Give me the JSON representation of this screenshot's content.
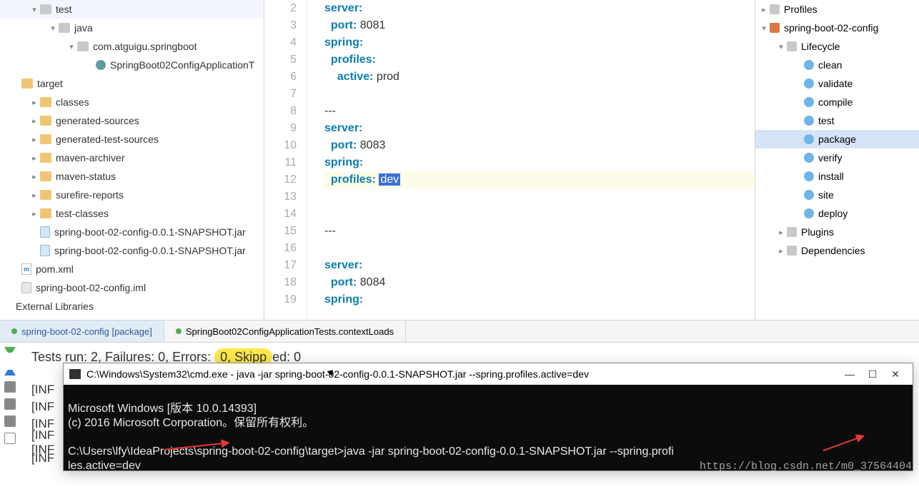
{
  "projectTree": {
    "items": [
      {
        "indent": 40,
        "arrow": "▾",
        "iconClass": "icon-folder gray",
        "label": "test"
      },
      {
        "indent": 66,
        "arrow": "▾",
        "iconClass": "icon-folder gray",
        "label": "java"
      },
      {
        "indent": 92,
        "arrow": "▾",
        "iconClass": "icon-folder gray",
        "label": "com.atguigu.springboot"
      },
      {
        "indent": 118,
        "arrow": "",
        "iconClass": "icon-class",
        "label": "SpringBoot02ConfigApplicationT"
      },
      {
        "indent": 14,
        "arrow": "",
        "iconClass": "icon-folder",
        "label": "target"
      },
      {
        "indent": 40,
        "arrow": "▸",
        "iconClass": "icon-folder",
        "label": "classes"
      },
      {
        "indent": 40,
        "arrow": "▸",
        "iconClass": "icon-folder",
        "label": "generated-sources"
      },
      {
        "indent": 40,
        "arrow": "▸",
        "iconClass": "icon-folder",
        "label": "generated-test-sources"
      },
      {
        "indent": 40,
        "arrow": "▸",
        "iconClass": "icon-folder",
        "label": "maven-archiver"
      },
      {
        "indent": 40,
        "arrow": "▸",
        "iconClass": "icon-folder",
        "label": "maven-status"
      },
      {
        "indent": 40,
        "arrow": "▸",
        "iconClass": "icon-folder",
        "label": "surefire-reports"
      },
      {
        "indent": 40,
        "arrow": "▸",
        "iconClass": "icon-folder",
        "label": "test-classes"
      },
      {
        "indent": 40,
        "arrow": "",
        "iconClass": "icon-jar",
        "label": "spring-boot-02-config-0.0.1-SNAPSHOT.jar"
      },
      {
        "indent": 40,
        "arrow": "",
        "iconClass": "icon-jar",
        "label": "spring-boot-02-config-0.0.1-SNAPSHOT.jar"
      },
      {
        "indent": 14,
        "arrow": "",
        "iconClass": "icon-xml",
        "label": "pom.xml",
        "iconText": "m"
      },
      {
        "indent": 14,
        "arrow": "",
        "iconClass": "icon-file",
        "label": "spring-boot-02-config.iml"
      },
      {
        "indent": 6,
        "arrow": "",
        "iconClass": "",
        "label": "External Libraries"
      }
    ]
  },
  "editor": {
    "lines": [
      {
        "n": 2,
        "segments": [
          {
            "t": "server:",
            "cls": "key"
          }
        ]
      },
      {
        "n": 3,
        "segments": [
          {
            "t": "  ",
            "cls": ""
          },
          {
            "t": "port:",
            "cls": "key"
          },
          {
            "t": " 8081",
            "cls": "val"
          }
        ]
      },
      {
        "n": 4,
        "segments": [
          {
            "t": "spring:",
            "cls": "key"
          }
        ]
      },
      {
        "n": 5,
        "segments": [
          {
            "t": "  ",
            "cls": ""
          },
          {
            "t": "profiles:",
            "cls": "key"
          }
        ]
      },
      {
        "n": 6,
        "segments": [
          {
            "t": "    ",
            "cls": ""
          },
          {
            "t": "active:",
            "cls": "key"
          },
          {
            "t": " prod",
            "cls": "val"
          }
        ]
      },
      {
        "n": 7,
        "segments": []
      },
      {
        "n": 8,
        "segments": [
          {
            "t": "---",
            "cls": "val"
          }
        ]
      },
      {
        "n": 9,
        "segments": [
          {
            "t": "server:",
            "cls": "key"
          }
        ]
      },
      {
        "n": 10,
        "segments": [
          {
            "t": "  ",
            "cls": ""
          },
          {
            "t": "port:",
            "cls": "key"
          },
          {
            "t": " 8083",
            "cls": "val"
          }
        ]
      },
      {
        "n": 11,
        "segments": [
          {
            "t": "spring:",
            "cls": "key"
          }
        ]
      },
      {
        "n": 12,
        "hl": true,
        "segments": [
          {
            "t": "  ",
            "cls": ""
          },
          {
            "t": "profiles:",
            "cls": "key"
          },
          {
            "t": " ",
            "cls": ""
          },
          {
            "t": "dev",
            "cls": "sel"
          }
        ]
      },
      {
        "n": 13,
        "segments": []
      },
      {
        "n": 14,
        "segments": []
      },
      {
        "n": 15,
        "segments": [
          {
            "t": "---",
            "cls": "val"
          }
        ]
      },
      {
        "n": 16,
        "segments": []
      },
      {
        "n": 17,
        "segments": [
          {
            "t": "server:",
            "cls": "key"
          }
        ]
      },
      {
        "n": 18,
        "segments": [
          {
            "t": "  ",
            "cls": ""
          },
          {
            "t": "port:",
            "cls": "key"
          },
          {
            "t": " 8084",
            "cls": "val"
          }
        ]
      },
      {
        "n": 19,
        "segments": [
          {
            "t": "spring:",
            "cls": "key"
          }
        ]
      }
    ]
  },
  "mavenPanel": {
    "items": [
      {
        "indent": 4,
        "arrow": "▸",
        "iconClass": "fold-icon",
        "label": "Profiles"
      },
      {
        "indent": 4,
        "arrow": "▾",
        "iconClass": "mvn-icon",
        "label": "spring-boot-02-config"
      },
      {
        "indent": 28,
        "arrow": "▾",
        "iconClass": "fold-icon",
        "label": "Lifecycle"
      },
      {
        "indent": 52,
        "arrow": "",
        "iconClass": "gear",
        "label": "clean"
      },
      {
        "indent": 52,
        "arrow": "",
        "iconClass": "gear",
        "label": "validate"
      },
      {
        "indent": 52,
        "arrow": "",
        "iconClass": "gear",
        "label": "compile"
      },
      {
        "indent": 52,
        "arrow": "",
        "iconClass": "gear",
        "label": "test"
      },
      {
        "indent": 52,
        "arrow": "",
        "iconClass": "gear",
        "label": "package",
        "selected": true
      },
      {
        "indent": 52,
        "arrow": "",
        "iconClass": "gear",
        "label": "verify"
      },
      {
        "indent": 52,
        "arrow": "",
        "iconClass": "gear",
        "label": "install"
      },
      {
        "indent": 52,
        "arrow": "",
        "iconClass": "gear",
        "label": "site"
      },
      {
        "indent": 52,
        "arrow": "",
        "iconClass": "gear",
        "label": "deploy"
      },
      {
        "indent": 28,
        "arrow": "▸",
        "iconClass": "fold-icon",
        "label": "Plugins"
      },
      {
        "indent": 28,
        "arrow": "▸",
        "iconClass": "fold-icon",
        "label": "Dependencies"
      }
    ]
  },
  "runTabs": {
    "active": "spring-boot-02-config [package]",
    "inactive": "SpringBoot02ConfigApplicationTests.contextLoads"
  },
  "console": {
    "testSummary": {
      "pre": "Tests run: 2, Failures: 0, Errors: ",
      "hl": "0,  Skipp",
      "post": "ed: 0"
    },
    "infoPrefix": "[INF",
    "cmd": {
      "title": "C:\\Windows\\System32\\cmd.exe - java  -jar spring-boot-02-config-0.0.1-SNAPSHOT.jar --spring.profiles.active=dev",
      "line1": "Microsoft Windows [版本 10.0.14393]",
      "line2": "(c) 2016 Microsoft Corporation。保留所有权利。",
      "line3": "",
      "line4": "C:\\Users\\lfy\\IdeaProjects\\spring-boot-02-config\\target>java -jar spring-boot-02-config-0.0.1-SNAPSHOT.jar --spring.profi",
      "line5": "les.active=dev"
    }
  },
  "watermark": "https://blog.csdn.net/m0_37564404"
}
